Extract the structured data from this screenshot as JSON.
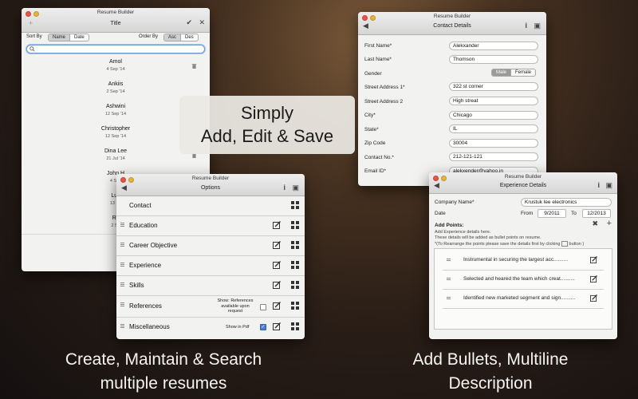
{
  "list_window": {
    "title": "Resume Builder",
    "nav_title": "Title",
    "sort_by_label": "Sort By",
    "sort_options": [
      "Name",
      "Date"
    ],
    "order_by_label": "Order By",
    "order_options": [
      "Asc",
      "Des"
    ],
    "search_placeholder": "",
    "items": [
      {
        "name": "Amol",
        "date": "4 Sep '14"
      },
      {
        "name": "Ankiis",
        "date": "2 Sep '14"
      },
      {
        "name": "Ashwini",
        "date": "12 Sep '14"
      },
      {
        "name": "Christopher",
        "date": "12 Sep '14"
      },
      {
        "name": "Dina Lee",
        "date": "21 Jul '14"
      },
      {
        "name": "John H",
        "date": "4 Sep"
      },
      {
        "name": "Lus",
        "date": "13 Se"
      },
      {
        "name": "Rit",
        "date": "2 Se"
      }
    ]
  },
  "overlay": {
    "line1": "Simply",
    "line2": "Add, Edit & Save"
  },
  "contact_window": {
    "title": "Resume Builder",
    "nav_title": "Contact Details",
    "fields": [
      {
        "label": "First Name*",
        "value": "Alekxander"
      },
      {
        "label": "Last Name*",
        "value": "Thomson"
      },
      {
        "label": "Street Address 1*",
        "value": "322 st corner"
      },
      {
        "label": "Street Address 2",
        "value": "High streat"
      },
      {
        "label": "City*",
        "value": "Chicago"
      },
      {
        "label": "State*",
        "value": "IL"
      },
      {
        "label": "Zip Code",
        "value": "30004"
      },
      {
        "label": "Contact No.*",
        "value": "212-121-121"
      },
      {
        "label": "Email ID*",
        "value": "alekxender@yahoo.in"
      }
    ],
    "gender_label": "Gender",
    "gender_options": [
      "Male",
      "Female"
    ]
  },
  "options_window": {
    "title": "Resume Builder",
    "nav_title": "Options",
    "items": [
      {
        "label": "Contact"
      },
      {
        "label": "Education"
      },
      {
        "label": "Career Objective"
      },
      {
        "label": "Experience"
      },
      {
        "label": "Skills"
      },
      {
        "label": "References"
      },
      {
        "label": "Miscellaneous"
      }
    ],
    "references_note": "Show: References available upon request",
    "pdf_note": "Show in Pdf"
  },
  "experience_window": {
    "title": "Resume Builder",
    "nav_title": "Experience Details",
    "company_label": "Company Name*",
    "company_value": "Krustuk lee electronics",
    "date_label": "Date",
    "from_label": "From",
    "from_value": "9/2011",
    "to_label": "To",
    "to_value": "12/2013",
    "add_points_label": "Add Points:",
    "help_line1": "Add Experience details here.",
    "help_line2": "These details will be added as bullet points on resume.",
    "help_line3": "*(To Rearrange the points please save the details first by clicking",
    "help_line3_end": "button )",
    "points": [
      "Instrumental in securing the largest acc..........",
      "Selected and heared the team which creat..........",
      "Identified new marketed segment and sign.........."
    ]
  },
  "captions": {
    "left_line1": "Create, Maintain & Search",
    "left_line2": "multiple resumes",
    "right_line1": "Add Bullets, Multiline",
    "right_line2": "Description"
  },
  "colors": {
    "accent_seg": "#cfcfcf",
    "caption_text": "#f4f4f4"
  }
}
